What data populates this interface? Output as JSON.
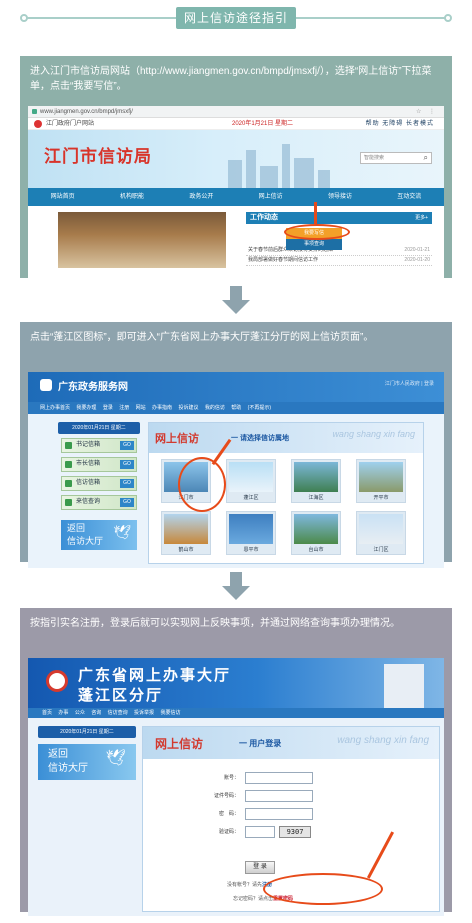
{
  "header": {
    "title": "网上信访途径指引"
  },
  "step1": {
    "text": "进入江门市信访局网站（http://www.jiangmen.gov.cn/bmpd/jmsxfj/），选择“网上信访”下拉菜单，点击“我要写信”。",
    "browser_url": "www.jiangmen.gov.cn/bmpd/jmsxfj/",
    "site_link": "江门政府门户网站",
    "date": "2020年1月21日 星期二",
    "tools": [
      "帮助",
      "无障碍",
      "长者模式"
    ],
    "site_title": "江门市信访局",
    "search_placeholder": "智能搜索",
    "nav": [
      "网站首页",
      "机构职能",
      "政务公开",
      "网上信访",
      "领导接访",
      "互动交流"
    ],
    "dropdown": [
      "我要写信",
      "事项查询"
    ],
    "section_title": "工作动态",
    "more": "更多+",
    "news": [
      {
        "title": "关于春节前后群众来访接待安排的通知",
        "date": "2020-01-21"
      },
      {
        "title": "我局部署做好春节期间信访工作",
        "date": "2020-01-20"
      }
    ]
  },
  "step2": {
    "text": "点击“蓬江区图标”，即可进入“广东省网上办事大厅蓬江分厅的网上信访页面”。",
    "portal_name": "广东政务服务网",
    "portal_right": "江门市人民政府 | 登录",
    "nav": [
      "网上办事首页",
      "我要办理",
      "登录",
      "注册",
      "网站",
      "办事指南",
      "投诉建议",
      "我的信访",
      "帮助",
      "(不再提示)"
    ],
    "date": "2020年01月21日 星期二",
    "side_buttons": [
      "书记信箱",
      "市长信箱",
      "信访信箱",
      "来信查询"
    ],
    "go": "GO",
    "back_line1": "返回",
    "back_line2": "信访大厅",
    "banner_t1": "网上信访",
    "banner_t2": "一 请选择信访属地",
    "watermark": "wang shang xin fang",
    "cities": [
      "江门市",
      "蓬江区",
      "江海区",
      "开平市",
      "鹤山市",
      "恩平市",
      "台山市",
      "江门区"
    ]
  },
  "step3": {
    "text": "按指引实名注册，登录后就可以实现网上反映事项，并通过网络查询事项办理情况。",
    "hall_line1": "广东省网上办事大厅",
    "hall_line2": "蓬江区分厅",
    "nav": [
      "首页",
      "办事",
      "公众",
      "咨询",
      "信访查询",
      "投诉举报",
      "我要信访"
    ],
    "date": "2020年01月21日 星期二",
    "back_line1": "返回",
    "back_line2": "信访大厅",
    "banner_t1": "网上信访",
    "banner_t2": "一 用户登录",
    "watermark": "wang shang xin fang",
    "fields": [
      "账号：",
      "证件号码：",
      "密　码：",
      "验证码："
    ],
    "captcha": "9307",
    "login_button": "登 录",
    "register_text": "没有帐号？请先",
    "register_link": "注册",
    "forgot_text": "忘记密码？请点击",
    "forgot_link": "重置密码"
  },
  "colors": {
    "panel1": "#8eb0a9",
    "panel2": "#8ea3ad",
    "panel3": "#9c9aa8",
    "highlight": "#e74b1a"
  },
  "icons": [
    "down-arrow-icon"
  ]
}
